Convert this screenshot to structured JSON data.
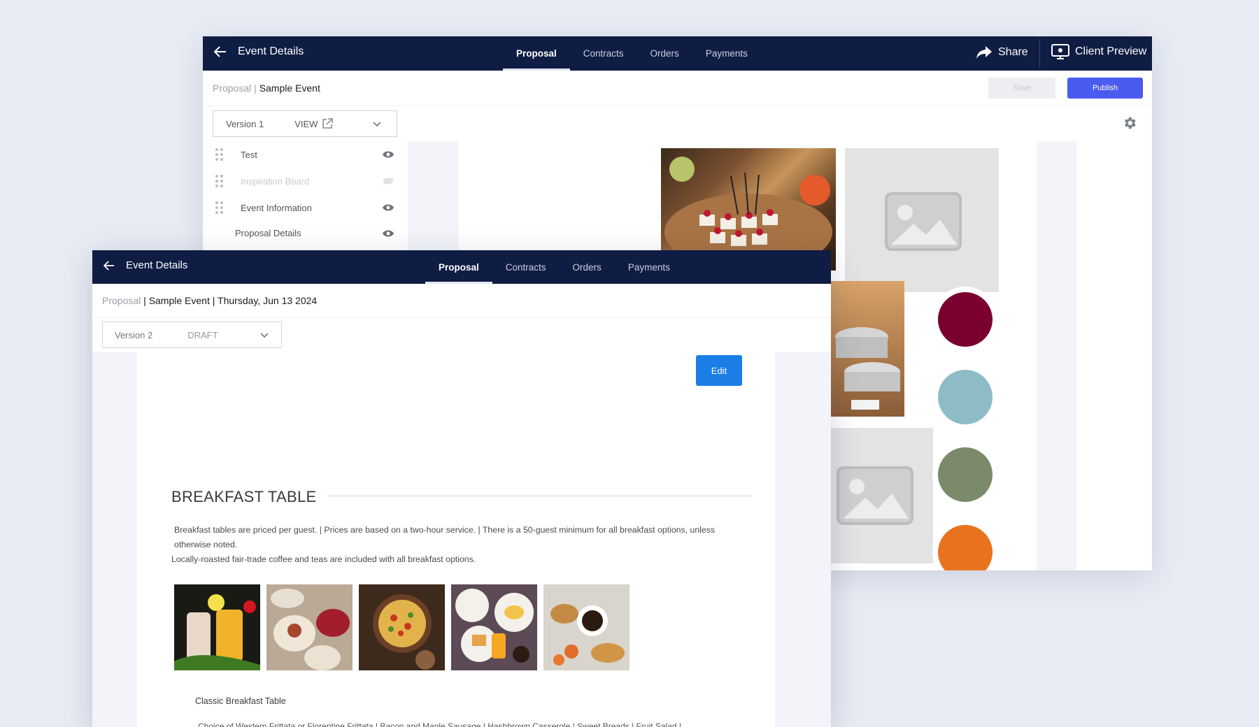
{
  "back_window": {
    "title": "Event Details",
    "tabs": [
      "Proposal",
      "Contracts",
      "Orders",
      "Payments"
    ],
    "share_label": "Share",
    "client_preview_label": "Client Preview",
    "breadcrumb": {
      "section": "Proposal",
      "separator": "|",
      "event": "Sample Event"
    },
    "save_label": "Save",
    "publish_label": "Publish",
    "version": {
      "label": "Version 1",
      "action": "VIEW"
    },
    "layers": [
      {
        "label": "Test",
        "visible": true
      },
      {
        "label": "Inspiration Board",
        "visible": false
      },
      {
        "label": "Event Information",
        "visible": true
      },
      {
        "label": "Proposal Details",
        "visible": true
      }
    ],
    "palette": [
      "#7a0030",
      "#8dbbc6",
      "#7a8a6a",
      "#e8731e"
    ]
  },
  "front_window": {
    "title": "Event Details",
    "tabs": [
      "Proposal",
      "Contracts",
      "Orders",
      "Payments"
    ],
    "breadcrumb": {
      "section": "Proposal",
      "separator": "|",
      "event": "Sample Event",
      "separator2": "|",
      "date": "Thursday, Jun 13 2024"
    },
    "version": {
      "label": "Version 2",
      "status": "DRAFT"
    },
    "edit_label": "Edit",
    "section_title": "BREAKFAST TABLE",
    "description_line1": "Breakfast tables are priced per guest. | Prices are based on a two-hour service. | There is a 50-guest minimum for all breakfast options, unless otherwise noted.",
    "description_line2": "Locally-roasted fair-trade coffee and teas are included with all breakfast options.",
    "item_title": "Classic Breakfast Table",
    "item_detail": "Choice of Western Frittata or Florentine Frittata | Bacon and Maple Sausage | Hashbrown Casserole | Sweet Breads | Fruit Salad |"
  },
  "colors": {
    "nav": "#0f1d44",
    "publish": "#4a5cf0",
    "edit": "#1a7ee6"
  }
}
